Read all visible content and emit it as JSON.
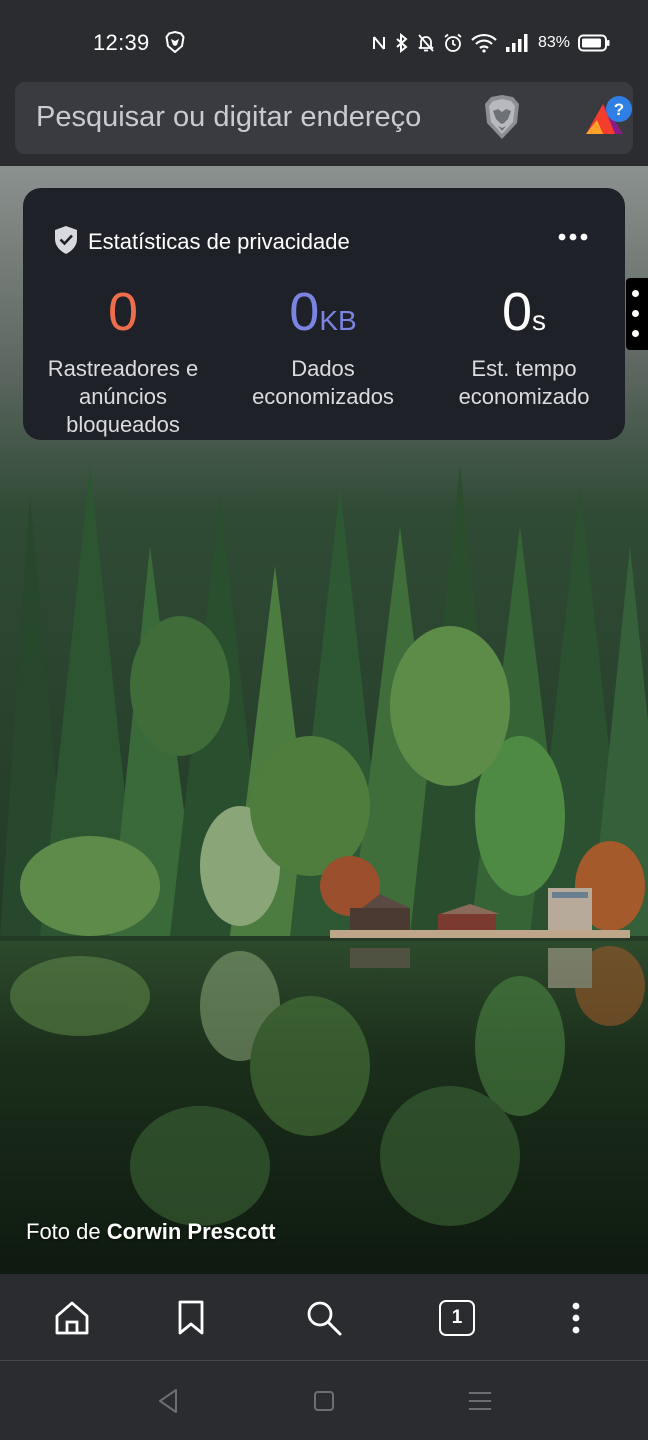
{
  "status_bar": {
    "time": "12:39",
    "battery_percent": "83%",
    "icons": [
      "brave-icon",
      "nfc-icon",
      "bluetooth-icon",
      "bell-off-icon",
      "alarm-icon",
      "wifi-icon",
      "signal-icon",
      "battery-icon"
    ]
  },
  "address_bar": {
    "placeholder": "Pesquisar ou digitar endereço",
    "icons": [
      "brave-shields-icon",
      "brave-rewards-icon"
    ]
  },
  "privacy_stats": {
    "title": "Estatísticas de privacidade",
    "stats": [
      {
        "value": "0",
        "unit": "",
        "label": "Rastreadores e anúncios bloqueados",
        "color": "#ee6d4c"
      },
      {
        "value": "0",
        "unit": "KB",
        "label": "Dados economizados",
        "color": "#7b83e3"
      },
      {
        "value": "0",
        "unit": "s",
        "label": "Est. tempo economizado",
        "color": "#ffffff"
      }
    ]
  },
  "photo_credit": {
    "prefix": "Foto de",
    "author": "Corwin Prescott"
  },
  "bottom_toolbar": {
    "tab_count": "1",
    "items": [
      "home-icon",
      "bookmark-icon",
      "search-icon",
      "tabs-icon",
      "more-vertical-icon"
    ]
  },
  "nav_bar": {
    "items": [
      "back-icon",
      "home-square-icon",
      "recents-icon"
    ]
  },
  "colors": {
    "background": "#2b2c30",
    "urlbar": "#3a3b40",
    "card": "#1f2128"
  }
}
